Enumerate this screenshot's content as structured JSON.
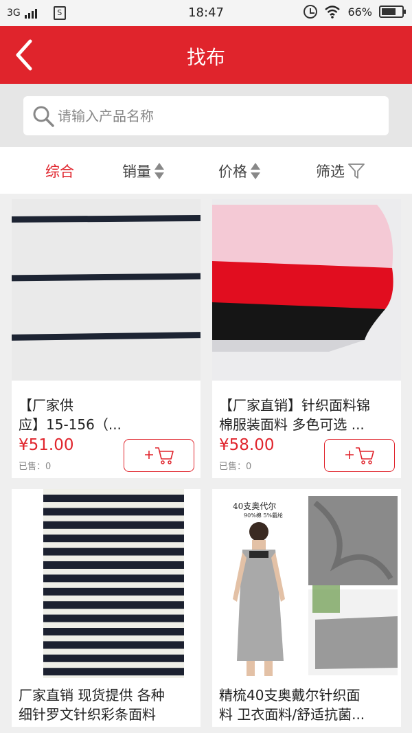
{
  "status_bar": {
    "network": "3G",
    "time": "18:47",
    "battery": "66%"
  },
  "header": {
    "title": "找布"
  },
  "search": {
    "placeholder": "请输入产品名称"
  },
  "sort": {
    "items": [
      {
        "label": "综合"
      },
      {
        "label": "销量"
      },
      {
        "label": "价格"
      },
      {
        "label": "筛选"
      }
    ]
  },
  "colors": {
    "brand": "#e0242c"
  },
  "products": [
    {
      "name": "【厂家供应】15-156（...",
      "name_lines": [
        "【厂家供",
        "应】15-156（..."
      ],
      "price": "¥51.00",
      "sold": "已售：0"
    },
    {
      "name": "【厂家直销】针织面料锦棉服装面料 多色可选 ...",
      "name_lines": [
        "【厂家直销】针织面料锦",
        "棉服装面料 多色可选 ..."
      ],
      "price": "¥58.00",
      "sold": "已售：0"
    },
    {
      "name": "厂家直销 现货提供 各种细针罗文针织彩条面料",
      "name_lines": [
        "厂家直销 现货提供 各种",
        "细针罗文针织彩条面料"
      ]
    },
    {
      "name": "精梳40支奥戴尔针织面料 卫衣面料/舒适抗菌...",
      "name_lines": [
        "精梳40支奥戴尔针织面",
        "料 卫衣面料/舒适抗菌..."
      ],
      "image_text": [
        "40支奥代尔",
        "90%棉 5%氨纶"
      ]
    }
  ]
}
